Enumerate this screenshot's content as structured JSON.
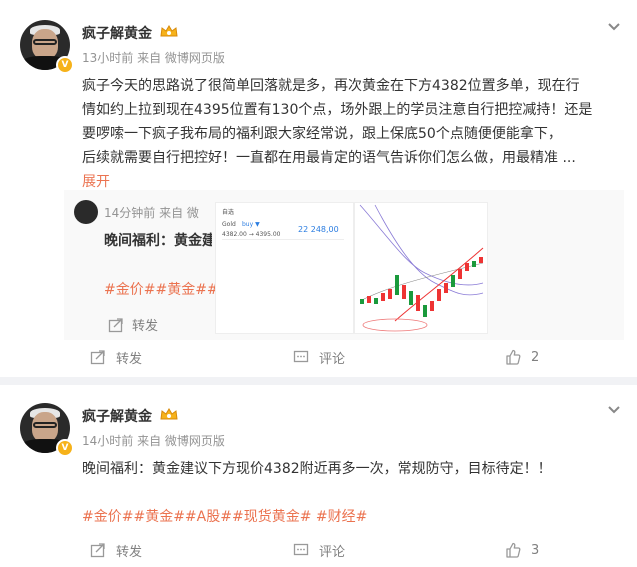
{
  "posts": [
    {
      "username": "疯子解黄金",
      "meta": "13小时前  来自 微博网页版",
      "text_lines": [
        "疯子今天的思路说了很简单回落就是多，再次黄金在下方4382位置多单，现在行",
        "情如约上拉到现在4395位置有130个点，场外跟上的学员注意自行把控减持！还是",
        "要啰嗦一下疯子我布局的福利跟大家经常说，跟上保底50个点随便便能拿下，",
        "后续就需要自行把控好！一直都在用最肯定的语气告诉你们怎么做，用最精准 ..."
      ],
      "expand_label": "展开",
      "repost": {
        "meta": "14分钟前  来自 微",
        "text": "晚间福利：黄金建",
        "tags": "#金价##黄金##",
        "forward_label": "转发",
        "image1": {
          "title": "自选",
          "symbol": "Gold",
          "sub": "buy ▼",
          "price": "22 248,00",
          "line": "4382.00 → 4395.00"
        }
      },
      "actions": {
        "forward": "转发",
        "comment": "评论",
        "like_count": "2"
      }
    },
    {
      "username": "疯子解黄金",
      "meta": "14小时前  来自 微博网页版",
      "text": "晚间福利：黄金建议下方现价4382附近再多一次，常规防守，目标待定！！",
      "tags": "#金价##黄金##A股##现货黄金# #财经#",
      "actions": {
        "forward": "转发",
        "comment": "评论",
        "like_count": "3"
      }
    }
  ],
  "colors": {
    "link": "#eb7350",
    "meta": "#939393",
    "badge": "#f6b21a"
  }
}
